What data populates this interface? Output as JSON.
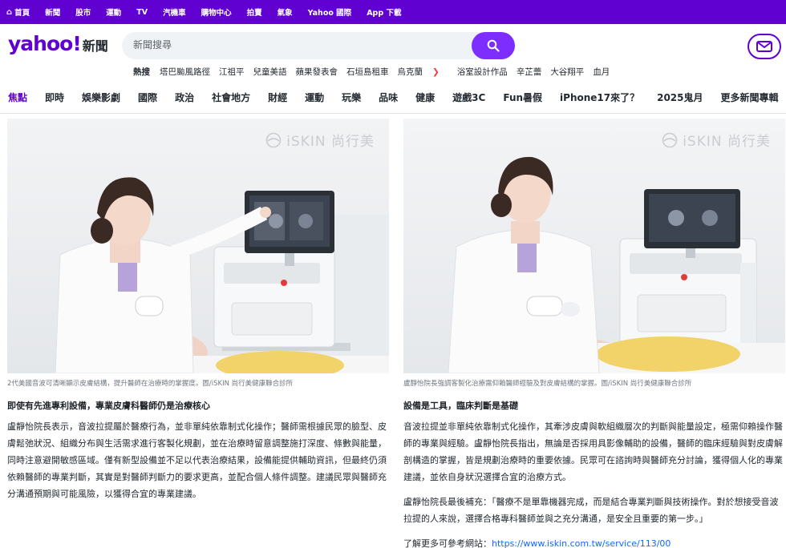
{
  "topbar": {
    "items": [
      "首頁",
      "新聞",
      "股市",
      "運動",
      "TV",
      "汽機車",
      "購物中心",
      "拍賣",
      "氣象",
      "Yahoo 國際",
      "App 下載"
    ]
  },
  "header": {
    "logo_text": "yahoo!",
    "logo_section": "新聞",
    "search_placeholder": "新聞搜尋",
    "trending_label": "熱搜",
    "trending": [
      "塔巴颱風路徑",
      "江祖平",
      "兒童美語",
      "蘋果發表會",
      "石垣島租車",
      "烏克蘭",
      "浴室設計作品",
      "辛芷蕾",
      "大谷翔平",
      "血月"
    ]
  },
  "nav": {
    "items": [
      "焦點",
      "即時",
      "娛樂影劇",
      "國際",
      "政治",
      "社會地方",
      "財經",
      "運動",
      "玩樂",
      "品味",
      "健康",
      "遊戲3C",
      "Fun暑假",
      "iPhone17來了？",
      "2025鬼月",
      "更多新聞專輯"
    ]
  },
  "article": {
    "watermark": "iSKIN 尚行美",
    "left": {
      "caption": "2代美國音波可清晰顯示皮膚結構，提升醫師在治療時的掌握度。圖/iSKIN 尚行美健康聯合診所",
      "subhead": "即使有先進專利設備，專業皮膚科醫師仍是治療核心",
      "paragraph": "盧靜怡院長表示，音波拉提屬於醫療行為，並非單純依靠制式化操作；醫師需根據民眾的臉型、皮膚鬆弛狀況、組織分布與生活需求進行客製化規劃，並在治療時留意調整施打深度、條數與能量，同時注意避開敏感區域。僅有新型設備並不足以代表治療結果，設備能提供輔助資訊，但最終仍須依賴醫師的專業判斷，其實是對醫師判斷力的要求更高，並配合個人條件調整。建議民眾與醫師充分溝通預期與可能風險，以獲得合宜的專業建議。"
    },
    "right": {
      "caption": "盧靜怡院長強調客製化治療需仰賴醫師經驗及對皮膚結構的掌握。圖/iSKIN 尚行美健康聯合診所",
      "subhead": "設備是工具，臨床判斷是基礎",
      "paragraph1": "音波拉提並非單純依靠制式化操作，其牽涉皮膚與軟組織層次的判斷與能量設定，極需仰賴操作醫師的專業與經驗。盧靜怡院長指出，無論是否採用具影像輔助的設備，醫師的臨床經驗與對皮膚解剖構造的掌握，皆是規劃治療時的重要依據。民眾可在諮詢時與醫師充分討論，獲得個人化的專業建議，並依自身狀況選擇合宜的治療方式。",
      "paragraph2": "盧靜怡院長最後補充：「醫療不是單靠機器完成，而是結合專業判斷與技術操作。對於想接受音波拉提的人來說，選擇合格專科醫師並與之充分溝通，是安全且重要的第一步。」",
      "more_label": "了解更多可參考網站：",
      "more_link": "https://www.iskin.com.tw/service/113/00"
    }
  },
  "colors": {
    "brand": "#6001d2",
    "search_button": "#7d2eff",
    "link": "#0f69ff"
  }
}
